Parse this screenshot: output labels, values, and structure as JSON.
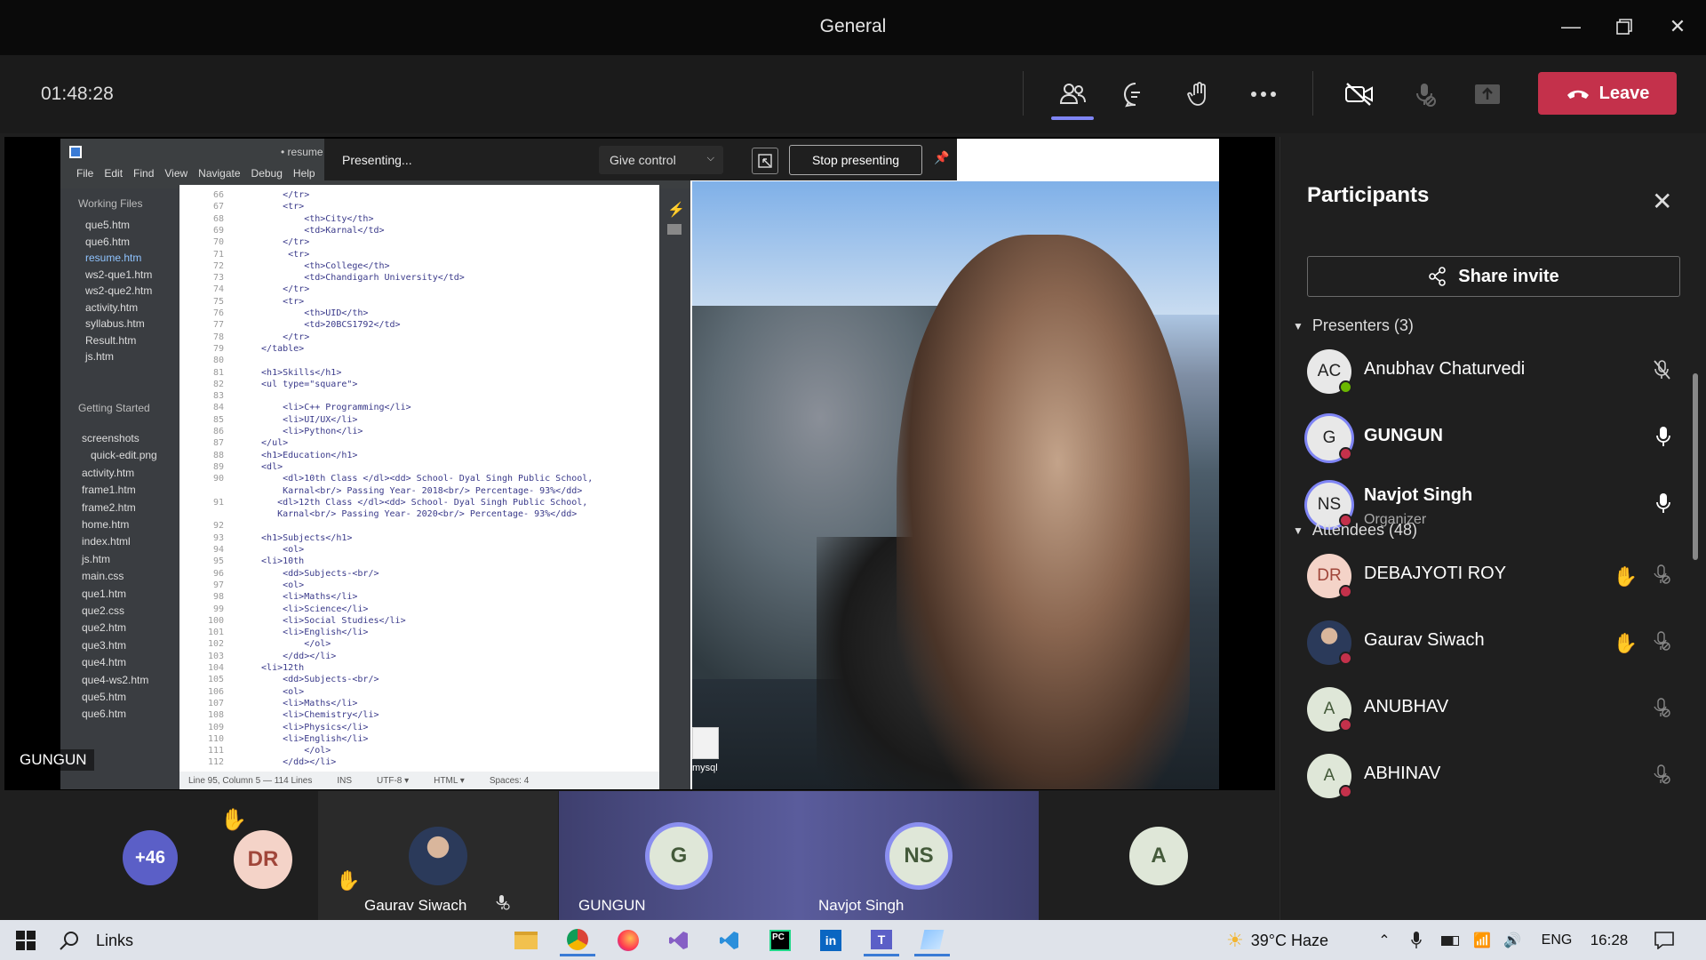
{
  "window": {
    "title": "General"
  },
  "toolbar": {
    "timer": "01:48:28",
    "leave_label": "Leave",
    "icons": [
      "people-icon",
      "chat-icon",
      "raise-hand-icon",
      "more-icon",
      "camera-off-icon",
      "mic-off-icon",
      "share-tray-icon"
    ]
  },
  "presenting_bar": {
    "status": "Presenting...",
    "give_control": "Give control",
    "stop": "Stop presenting"
  },
  "shared_editor": {
    "tab": "• resume",
    "menu": [
      "File",
      "Edit",
      "Find",
      "View",
      "Navigate",
      "Debug",
      "Help"
    ],
    "working_files_label": "Working Files",
    "working_files": [
      "que5.htm",
      "que6.htm",
      "resume.htm",
      "ws2-que1.htm",
      "ws2-que2.htm",
      "activity.htm",
      "syllabus.htm",
      "Result.htm",
      "js.htm"
    ],
    "getting_started_label": "Getting Started",
    "tree": [
      "screenshots",
      "quick-edit.png",
      "activity.htm",
      "frame1.htm",
      "frame2.htm",
      "home.htm",
      "index.html",
      "js.htm",
      "main.css",
      "que1.htm",
      "que2.css",
      "que2.htm",
      "que3.htm",
      "que4.htm",
      "que4-ws2.htm",
      "que5.htm",
      "que6.htm"
    ],
    "lines": [
      {
        "n": "66",
        "t": "      </tr>"
      },
      {
        "n": "67",
        "t": "      <tr>"
      },
      {
        "n": "68",
        "t": "          <th>City</th>"
      },
      {
        "n": "69",
        "t": "          <td>Karnal</td>"
      },
      {
        "n": "70",
        "t": "      </tr>"
      },
      {
        "n": "71",
        "t": "       <tr>"
      },
      {
        "n": "72",
        "t": "          <th>College</th>"
      },
      {
        "n": "73",
        "t": "          <td>Chandigarh University</td>"
      },
      {
        "n": "74",
        "t": "      </tr>"
      },
      {
        "n": "75",
        "t": "      <tr>"
      },
      {
        "n": "76",
        "t": "          <th>UID</th>"
      },
      {
        "n": "77",
        "t": "          <td>20BCS1792</td>"
      },
      {
        "n": "78",
        "t": "      </tr>"
      },
      {
        "n": "79",
        "t": "  </table>"
      },
      {
        "n": "80",
        "t": ""
      },
      {
        "n": "81",
        "t": "  <h1>Skills</h1>"
      },
      {
        "n": "82",
        "t": "  <ul type=\"square\">"
      },
      {
        "n": "83",
        "t": ""
      },
      {
        "n": "84",
        "t": "      <li>C++ Programming</li>"
      },
      {
        "n": "85",
        "t": "      <li>UI/UX</li>"
      },
      {
        "n": "86",
        "t": "      <li>Python</li>"
      },
      {
        "n": "87",
        "t": "  </ul>"
      },
      {
        "n": "88",
        "t": "  <h1>Education</h1>"
      },
      {
        "n": "89",
        "t": "  <dl>"
      },
      {
        "n": "90",
        "t": "      <dl>10th Class </dl><dd> School- Dyal Singh Public School,"
      },
      {
        "n": "",
        "t": "      Karnal<br/> Passing Year- 2018<br/> Percentage- 93%</dd>"
      },
      {
        "n": "91",
        "t": "     <dl>12th Class </dl><dd> School- Dyal Singh Public School,"
      },
      {
        "n": "",
        "t": "     Karnal<br/> Passing Year- 2020<br/> Percentage- 93%</dd>"
      },
      {
        "n": "92",
        "t": ""
      },
      {
        "n": "93",
        "t": "  <h1>Subjects</h1>"
      },
      {
        "n": "94",
        "t": "      <ol>"
      },
      {
        "n": "95",
        "t": "  <li>10th"
      },
      {
        "n": "96",
        "t": "      <dd>Subjects-<br/>"
      },
      {
        "n": "97",
        "t": "      <ol>"
      },
      {
        "n": "98",
        "t": "      <li>Maths</li>"
      },
      {
        "n": "99",
        "t": "      <li>Science</li>"
      },
      {
        "n": "100",
        "t": "      <li>Social Studies</li>"
      },
      {
        "n": "101",
        "t": "      <li>English</li>"
      },
      {
        "n": "102",
        "t": "          </ol>"
      },
      {
        "n": "103",
        "t": "      </dd></li>"
      },
      {
        "n": "104",
        "t": "  <li>12th"
      },
      {
        "n": "105",
        "t": "      <dd>Subjects-<br/>"
      },
      {
        "n": "106",
        "t": "      <ol>"
      },
      {
        "n": "107",
        "t": "      <li>Maths</li>"
      },
      {
        "n": "108",
        "t": "      <li>Chemistry</li>"
      },
      {
        "n": "109",
        "t": "      <li>Physics</li>"
      },
      {
        "n": "110",
        "t": "      <li>English</li>"
      },
      {
        "n": "111",
        "t": "          </ol>"
      },
      {
        "n": "112",
        "t": "      </dd></li>"
      }
    ],
    "status": [
      "Line 95, Column 5 — 114 Lines",
      "INS",
      "UTF-8 ▾",
      "HTML ▾",
      "Spaces: 4"
    ],
    "desktop_file_label": "mysql"
  },
  "stage": {
    "speaker_tag": "GUNGUN"
  },
  "gallery": {
    "overflow": "+46",
    "tiles": [
      {
        "initials": "DR",
        "name": ""
      },
      {
        "initials": "",
        "name": "Gaurav Siwach"
      },
      {
        "initials": "G",
        "name": "GUNGUN"
      },
      {
        "initials": "NS",
        "name": "Navjot Singh"
      },
      {
        "initials": "A",
        "name": ""
      }
    ]
  },
  "participants": {
    "title": "Participants",
    "share_invite": "Share invite",
    "presenters_label": "Presenters (3)",
    "attendees_label": "Attendees (48)",
    "presenters": [
      {
        "initials": "AC",
        "name": "Anubhav Chaturvedi",
        "role": "",
        "status_color": "#6bb700"
      },
      {
        "initials": "G",
        "name": "GUNGUN",
        "role": "",
        "status_color": "#c4314b"
      },
      {
        "initials": "NS",
        "name": "Navjot Singh",
        "role": "Organizer",
        "status_color": "#c4314b"
      }
    ],
    "attendees": [
      {
        "initials": "DR",
        "name": "DEBAJYOTI ROY",
        "status_color": "#c4314b"
      },
      {
        "initials": "",
        "name": "Gaurav Siwach",
        "status_color": "#c4314b"
      },
      {
        "initials": "A",
        "name": "ANUBHAV",
        "status_color": "#c4314b"
      },
      {
        "initials": "A",
        "name": "ABHINAV",
        "status_color": "#c4314b"
      }
    ]
  },
  "taskbar": {
    "search_label": "Links",
    "weather": "39°C  Haze",
    "language": "ENG",
    "clock": "16:28"
  },
  "colors": {
    "accent": "#7f85f5",
    "leave": "#c4314b",
    "hand": "#f2b531"
  }
}
